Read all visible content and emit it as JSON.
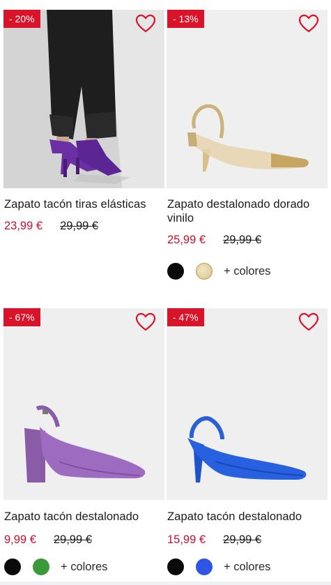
{
  "products": [
    {
      "badge": "- 20%",
      "name": "Zapato tacón tiras elásticas",
      "price": "23,99 €",
      "old_price": "29,99 €",
      "swatches": [],
      "more_colors": ""
    },
    {
      "badge": "- 13%",
      "name": "Zapato destalonado dorado vinilo",
      "price": "25,99 €",
      "old_price": "29,99 €",
      "swatches": [
        "black",
        "gold"
      ],
      "more_colors": "+ colores"
    },
    {
      "badge": "- 67%",
      "name": "Zapato tacón destalonado",
      "price": "9,99 €",
      "old_price": "29,99 €",
      "swatches": [
        "black",
        "green"
      ],
      "more_colors": "+ colores"
    },
    {
      "badge": "- 47%",
      "name": "Zapato tacón destalonado",
      "price": "15,99 €",
      "old_price": "29,99 €",
      "swatches": [
        "black",
        "blue"
      ],
      "more_colors": "+ colores"
    }
  ],
  "colors": {
    "badge_bg": "#d9132a",
    "price": "#c8102e",
    "heart": "#d9132a"
  },
  "icons": {
    "favorite": "heart-outline-icon"
  }
}
